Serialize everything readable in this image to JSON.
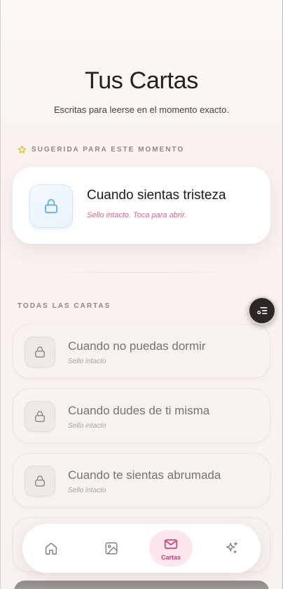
{
  "header": {
    "title": "Tus Cartas",
    "subtitle": "Escritas para leerse en el momento exacto."
  },
  "suggested": {
    "section_label": "SUGERIDA PARA ESTE MOMENTO",
    "section_icon": "star-icon",
    "card": {
      "title": "Cuando sientas tristeza",
      "status": "Sello intacto. Toca para abrir.",
      "icon": "lock-icon"
    }
  },
  "all_letters": {
    "section_label": "TODAS LAS CARTAS",
    "items": [
      {
        "title": "Cuando no puedas dormir",
        "status": "Sello intacto",
        "icon": "lock-icon"
      },
      {
        "title": "Cuando dudes de ti misma",
        "status": "Sello intacto",
        "icon": "lock-icon"
      },
      {
        "title": "Cuando te sientas abrumada",
        "status": "Sello intacto",
        "icon": "lock-icon"
      }
    ]
  },
  "fab": {
    "icon": "filter-list-icon"
  },
  "nav": {
    "items": [
      {
        "icon": "home-icon",
        "label": ""
      },
      {
        "icon": "gallery-icon",
        "label": ""
      },
      {
        "icon": "mail-icon",
        "label": "Cartas",
        "active": true
      },
      {
        "icon": "sparkles-icon",
        "label": ""
      }
    ]
  },
  "colors": {
    "accent_pink": "#e2608c",
    "nav_active": "#d23a6e",
    "lock_blue": "#5aaede",
    "text_dark": "#26201d",
    "muted": "#8f8682"
  }
}
